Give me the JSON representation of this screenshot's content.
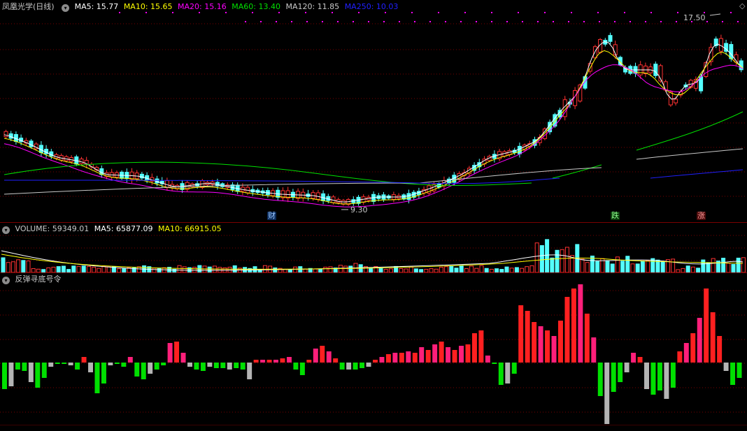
{
  "main": {
    "title": "凤凰光学(日线)",
    "ma": [
      {
        "label": "MA5: 15.77",
        "color": "#ffffff"
      },
      {
        "label": "MA10: 15.65",
        "color": "#ffff00"
      },
      {
        "label": "MA20: 15.16",
        "color": "#ff00ff"
      },
      {
        "label": "MA60: 13.40",
        "color": "#00e000"
      },
      {
        "label": "MA120: 11.85",
        "color": "#c8c8c8"
      },
      {
        "label": "MA250: 10.03",
        "color": "#0000ff"
      }
    ],
    "high_label": "17.50",
    "low_label": "9.30",
    "tags": {
      "cai": "财",
      "die": "跌",
      "zhang": "涨"
    }
  },
  "volume": {
    "label": "VOLUME: 59349.01",
    "ma5": "MA5: 65877.09",
    "ma10": "MA10: 66915.05"
  },
  "indicator": {
    "title": "反弹寻底号令"
  },
  "colors": {
    "up": "#ff3232",
    "down": "#54ffff",
    "grid": "#7a0000",
    "neg_green": "#00e000",
    "neg_gray": "#b4b4b4",
    "pink": "#ff1f7a"
  }
}
